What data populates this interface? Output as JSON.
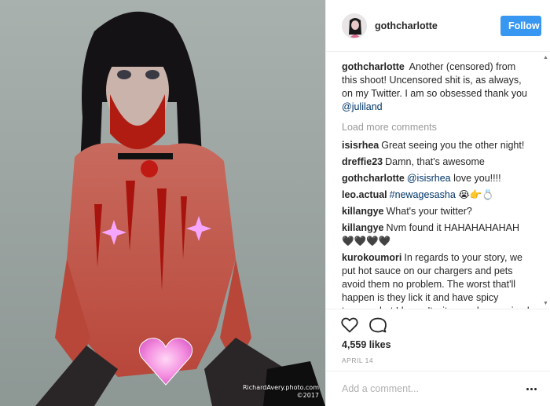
{
  "post": {
    "watermark_line1": "RichardAvery.photo.com",
    "watermark_line2": "©2017"
  },
  "header": {
    "username": "gothcharlotte",
    "follow_label": "Follow"
  },
  "caption": {
    "user": "gothcharlotte",
    "text": "Another (censored) from this shoot! Uncensored shit is, as always, on my Twitter. I am so obsessed thank you",
    "mention": "@juliland"
  },
  "load_more_label": "Load more comments",
  "comments": [
    {
      "user": "isisrhea",
      "text": "Great seeing you the other night!",
      "mention": ""
    },
    {
      "user": "dreffie23",
      "text": "Damn, that's awesome",
      "mention": ""
    },
    {
      "user": "gothcharlotte",
      "mention": "@isisrhea",
      "text": " love you!!!!"
    },
    {
      "user": "leo.actual",
      "mention": "#newagesasha",
      "text": " 😭👉💍"
    },
    {
      "user": "killangye",
      "text": "What's your twitter?",
      "mention": ""
    },
    {
      "user": "killangye",
      "text": "Nvm found it HAHAHAHAHAH 🖤🖤🖤🖤",
      "mention": ""
    },
    {
      "user": "kurokoumori",
      "text": "In regards to your story, we put hot sauce on our chargers and pets avoid them no problem. The worst that'll happen is they lick it and have spicy tongues but I haven't witnessed any animal do it yet. Or cat smells it from the distance",
      "mention": ""
    }
  ],
  "likes": "4,559 likes",
  "date": "APRIL 14",
  "add_comment": {
    "placeholder": "Add a comment..."
  },
  "icons": {
    "like": "heart-icon",
    "comment": "comment-bubble-icon",
    "more": "more-options-icon",
    "scroll_up": "scroll-up-arrow-icon",
    "scroll_down": "scroll-down-arrow-icon"
  },
  "colors": {
    "follow_button": "#3897f0",
    "mention": "#003569",
    "muted_text": "#999999",
    "divider": "#efefef"
  }
}
